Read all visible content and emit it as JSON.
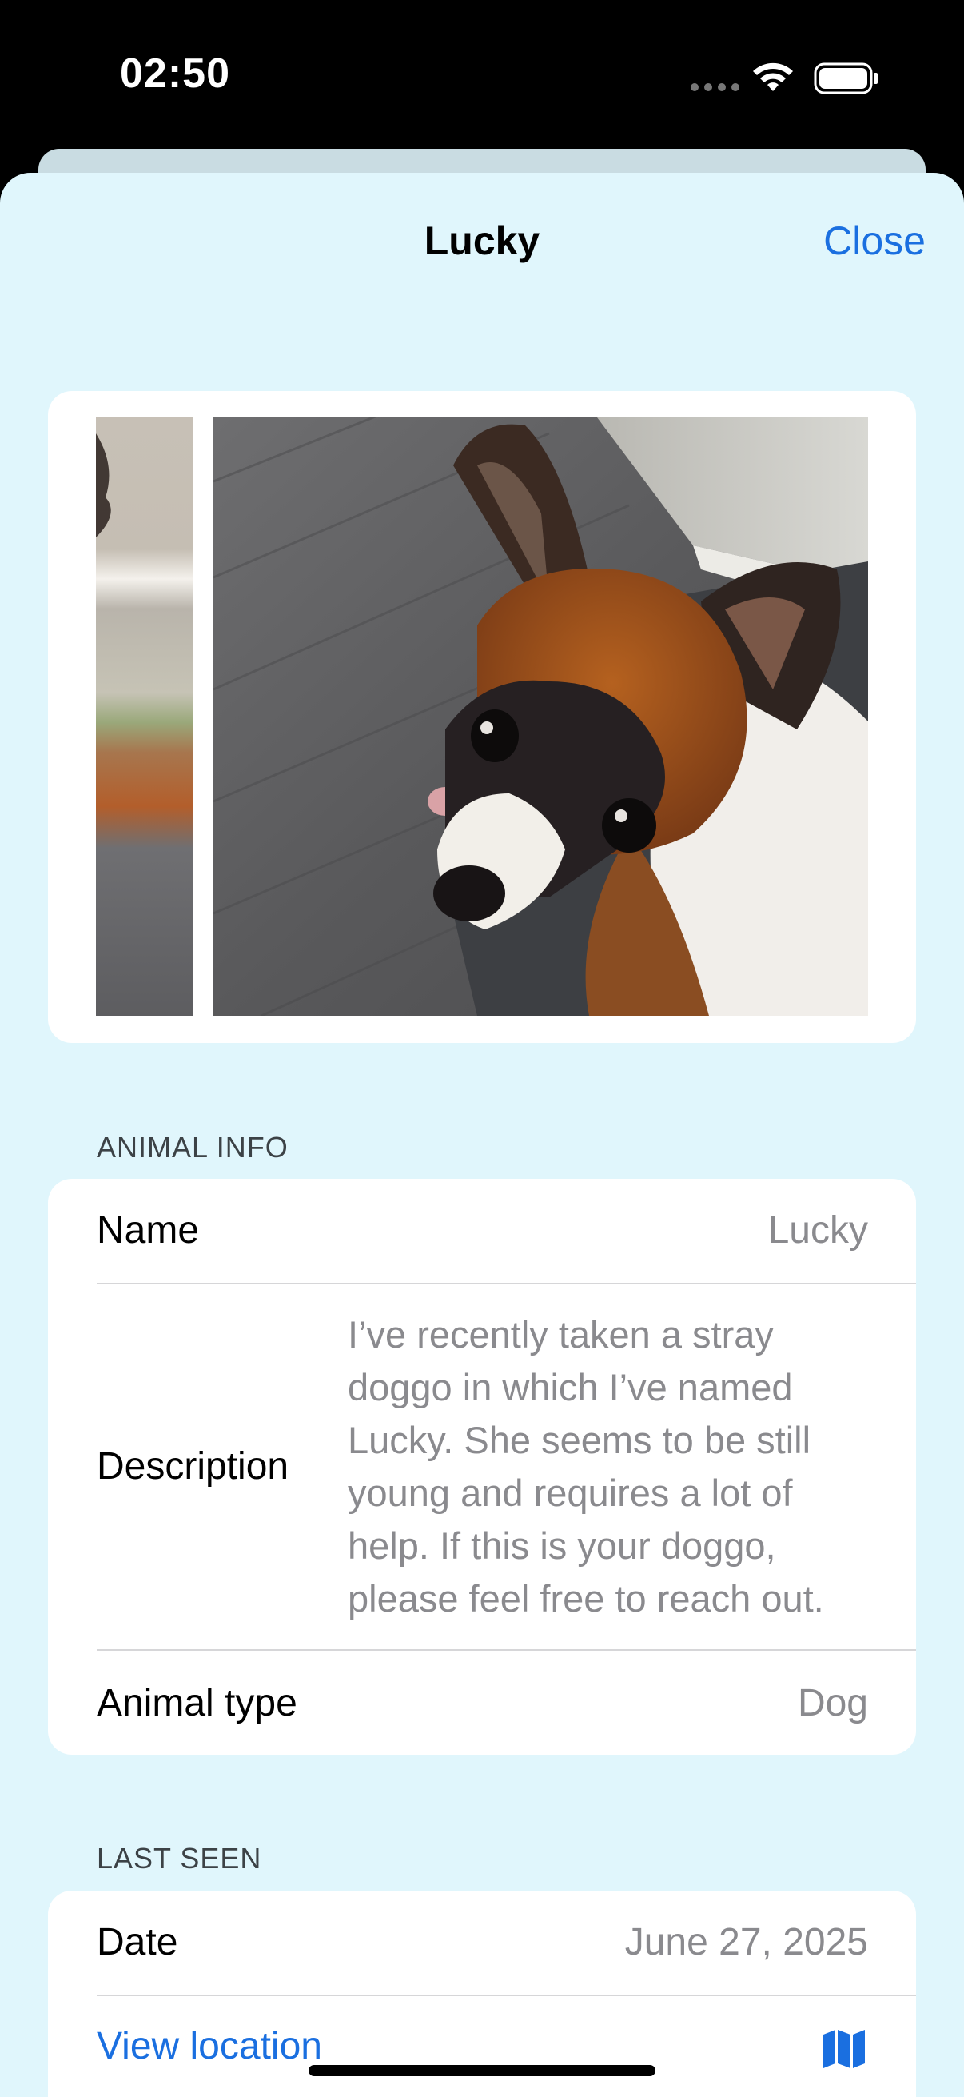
{
  "status_bar": {
    "time": "02:50"
  },
  "navigation": {
    "title": "Lucky",
    "close_label": "Close"
  },
  "photos": {
    "count_visible": 2,
    "subject": "dog photo"
  },
  "animal_info": {
    "header": "ANIMAL INFO",
    "name_label": "Name",
    "name_value": "Lucky",
    "description_label": "Description",
    "description_value": "I’ve recently taken a stray doggo in which I’ve named Lucky. She seems to be still young and requires a lot of help. If this is your doggo, please feel free to reach out.",
    "type_label": "Animal type",
    "type_value": "Dog"
  },
  "last_seen": {
    "header": "LAST SEEN",
    "date_label": "Date",
    "date_value": "June 27, 2025",
    "location_link": "View location",
    "location_icon": "map-icon"
  },
  "colors": {
    "sheet_background": "#e0f6fc",
    "accent": "#1a6fe0",
    "secondary_text": "#8a8a8e"
  }
}
